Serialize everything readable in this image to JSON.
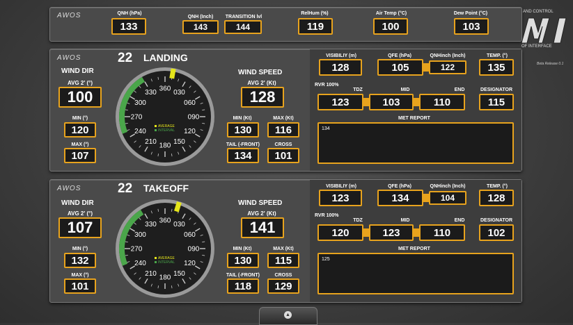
{
  "brand": "AWOS",
  "top": {
    "qnh_hpa_label": "QNH (hPa)",
    "qnh_hpa": "133",
    "qnh_inch_label": "QNH (Inch)",
    "qnh_inch": "143",
    "transition_label": "TRANSITION lvl",
    "transition": "144",
    "relhum_label": "RelHum (%)",
    "relhum": "119",
    "airtemp_label": "Air Temp (°C)",
    "airtemp": "100",
    "dewpoint_label": "Dew Point (°C)",
    "dewpoint": "103"
  },
  "corner": {
    "text_top": "AND CONTROL",
    "text_bottom": "OF INTERFACE",
    "release": "Beta Release 0.1"
  },
  "landing": {
    "runway": "22",
    "mode": "LANDING",
    "wind_dir_title": "WIND DIR",
    "avg_dir_label": "AVG 2' (°)",
    "avg_dir": "100",
    "min_dir_label": "MIN (°)",
    "min_dir": "120",
    "max_dir_label": "MAX (°)",
    "max_dir": "107",
    "wind_speed_title": "WIND SPEED",
    "avg_spd_label": "AVG 2' (Kt)",
    "avg_spd": "128",
    "min_spd_label": "MIN (Kt)",
    "min_spd": "130",
    "max_spd_label": "MAX (Kt)",
    "max_spd": "116",
    "tail_label": "TAIL (-FRONT)",
    "tail": "134",
    "cross_label": "CROSS",
    "cross": "101",
    "visibility_label": "VISIBILIY (m)",
    "visibility": "128",
    "qfe_label": "QFE (hPa)",
    "qfe": "105",
    "qnhinch_label": "QNHinch (Inch)",
    "qnhinch": "122",
    "temp_label": "TEMP. (°)",
    "temp": "135",
    "rvr_label": "RVR 100%",
    "tdz_label": "TDZ",
    "tdz": "123",
    "mid_label": "MID",
    "mid": "103",
    "end_label": "END",
    "end": "110",
    "designator_label": "DESIGNATOR",
    "designator": "115",
    "met_label": "MET REPORT",
    "met": "134"
  },
  "takeoff": {
    "runway": "22",
    "mode": "TAKEOFF",
    "wind_dir_title": "WIND DIR",
    "avg_dir_label": "AVG 2' (°)",
    "avg_dir": "107",
    "min_dir_label": "MIN (°)",
    "min_dir": "132",
    "max_dir_label": "MAX (°)",
    "max_dir": "101",
    "wind_speed_title": "WIND SPEED",
    "avg_spd_label": "AVG 2' (Kt)",
    "avg_spd": "141",
    "min_spd_label": "MIN (Kt)",
    "min_spd": "130",
    "max_spd_label": "MAX (Kt)",
    "max_spd": "115",
    "tail_label": "TAIL (-FRONT)",
    "tail": "118",
    "cross_label": "CROSS",
    "cross": "129",
    "visibility_label": "VISIBILIY (m)",
    "visibility": "123",
    "qfe_label": "QFE (hPa)",
    "qfe": "134",
    "qnhinch_label": "QNHinch (Inch)",
    "qnhinch": "104",
    "temp_label": "TEMP. (°)",
    "temp": "128",
    "rvr_label": "RVR 100%",
    "tdz_label": "TDZ",
    "tdz": "120",
    "mid_label": "MID",
    "mid": "123",
    "end_label": "END",
    "end": "110",
    "designator_label": "DESIGNATOR",
    "designator": "102",
    "met_label": "MET REPORT",
    "met": "125"
  },
  "compass": {
    "ticks": [
      "360",
      "030",
      "060",
      "090",
      "120",
      "150",
      "180",
      "210",
      "240",
      "270",
      "300",
      "330"
    ],
    "legend_average": "AVERAGE",
    "legend_interval": "INTERVAL"
  },
  "colors": {
    "accent": "#e8a31d",
    "interval": "#4aa64a",
    "average": "#e5e51a"
  }
}
